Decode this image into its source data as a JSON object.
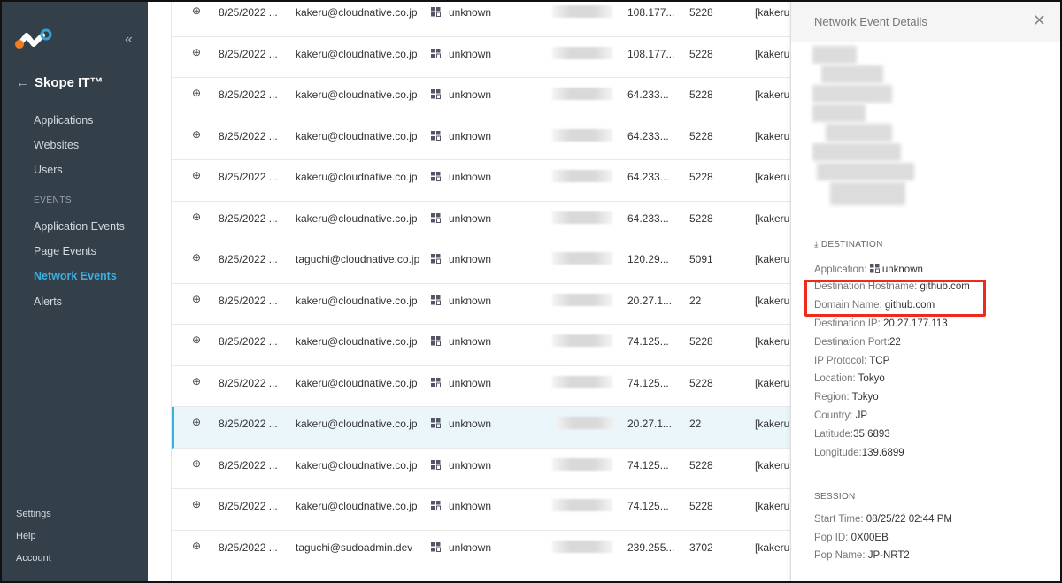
{
  "sidebar": {
    "collapse_icon": "double-chevron-left",
    "back_icon": "arrow-left",
    "title": "Skope IT™",
    "items": [
      "Applications",
      "Websites",
      "Users"
    ],
    "events_section": "EVENTS",
    "event_items": [
      "Application Events",
      "Page Events",
      "Network Events",
      "Alerts"
    ],
    "bottom": [
      "Settings",
      "Help",
      "Account"
    ]
  },
  "rows": [
    {
      "date": "8/25/2022 ...",
      "user": "kakeru@cloudnative.co.jp",
      "app": "unknown",
      "ip": "108.177...",
      "port": "5228",
      "user2": "[kakeru"
    },
    {
      "date": "8/25/2022 ...",
      "user": "kakeru@cloudnative.co.jp",
      "app": "unknown",
      "ip": "108.177...",
      "port": "5228",
      "user2": "[kakeru"
    },
    {
      "date": "8/25/2022 ...",
      "user": "kakeru@cloudnative.co.jp",
      "app": "unknown",
      "ip": "64.233...",
      "port": "5228",
      "user2": "[kakeru"
    },
    {
      "date": "8/25/2022 ...",
      "user": "kakeru@cloudnative.co.jp",
      "app": "unknown",
      "ip": "64.233...",
      "port": "5228",
      "user2": "[kakeru"
    },
    {
      "date": "8/25/2022 ...",
      "user": "kakeru@cloudnative.co.jp",
      "app": "unknown",
      "ip": "64.233...",
      "port": "5228",
      "user2": "[kakeru"
    },
    {
      "date": "8/25/2022 ...",
      "user": "kakeru@cloudnative.co.jp",
      "app": "unknown",
      "ip": "64.233...",
      "port": "5228",
      "user2": "[kakeru"
    },
    {
      "date": "8/25/2022 ...",
      "user": "taguchi@cloudnative.co.jp",
      "app": "unknown",
      "ip": "120.29...",
      "port": "5091",
      "user2": "[kakeru"
    },
    {
      "date": "8/25/2022 ...",
      "user": "kakeru@cloudnative.co.jp",
      "app": "unknown",
      "ip": "20.27.1...",
      "port": "22",
      "user2": "[kakeru"
    },
    {
      "date": "8/25/2022 ...",
      "user": "kakeru@cloudnative.co.jp",
      "app": "unknown",
      "ip": "74.125...",
      "port": "5228",
      "user2": "[kakeru"
    },
    {
      "date": "8/25/2022 ...",
      "user": "kakeru@cloudnative.co.jp",
      "app": "unknown",
      "ip": "74.125...",
      "port": "5228",
      "user2": "[kakeru"
    },
    {
      "date": "8/25/2022 ...",
      "user": "kakeru@cloudnative.co.jp",
      "app": "unknown",
      "ip": "20.27.1...",
      "port": "22",
      "user2": "[kakeru"
    },
    {
      "date": "8/25/2022 ...",
      "user": "kakeru@cloudnative.co.jp",
      "app": "unknown",
      "ip": "74.125...",
      "port": "5228",
      "user2": "[kakeru"
    },
    {
      "date": "8/25/2022 ...",
      "user": "kakeru@cloudnative.co.jp",
      "app": "unknown",
      "ip": "74.125...",
      "port": "5228",
      "user2": "[kakeru"
    },
    {
      "date": "8/25/2022 ...",
      "user": "taguchi@sudoadmin.dev",
      "app": "unknown",
      "ip": "239.255...",
      "port": "3702",
      "user2": "[kakeru"
    }
  ],
  "selected_row": 10,
  "panel": {
    "title": "Network Event Details",
    "close_icon": "close",
    "destination": {
      "header": "DESTINATION",
      "fields": [
        {
          "k": "Application: ",
          "v": "unknown"
        },
        {
          "k": "Destination Hostname: ",
          "v": "github.com"
        },
        {
          "k": "Domain Name: ",
          "v": "github.com"
        },
        {
          "k": "Destination IP: ",
          "v": "20.27.177.113"
        },
        {
          "k": "Destination Port:",
          "v": "22"
        },
        {
          "k": "IP Protocol: ",
          "v": "TCP"
        },
        {
          "k": "Location: ",
          "v": "Tokyo"
        },
        {
          "k": "Region: ",
          "v": "Tokyo"
        },
        {
          "k": "Country: ",
          "v": "JP"
        },
        {
          "k": "Latitude:",
          "v": "35.6893"
        },
        {
          "k": "Longitude:",
          "v": "139.6899"
        }
      ]
    },
    "session": {
      "header": "SESSION",
      "fields": [
        {
          "k": "Start Time: ",
          "v": "08/25/22 02:44 PM"
        },
        {
          "k": "Pop ID: ",
          "v": "0X00EB"
        },
        {
          "k": "Pop Name: ",
          "v": "JP-NRT2"
        }
      ]
    }
  },
  "colors": {
    "sidebar": "#333f49",
    "accent": "#3ab0e2",
    "highlight": "#f02a1a"
  }
}
